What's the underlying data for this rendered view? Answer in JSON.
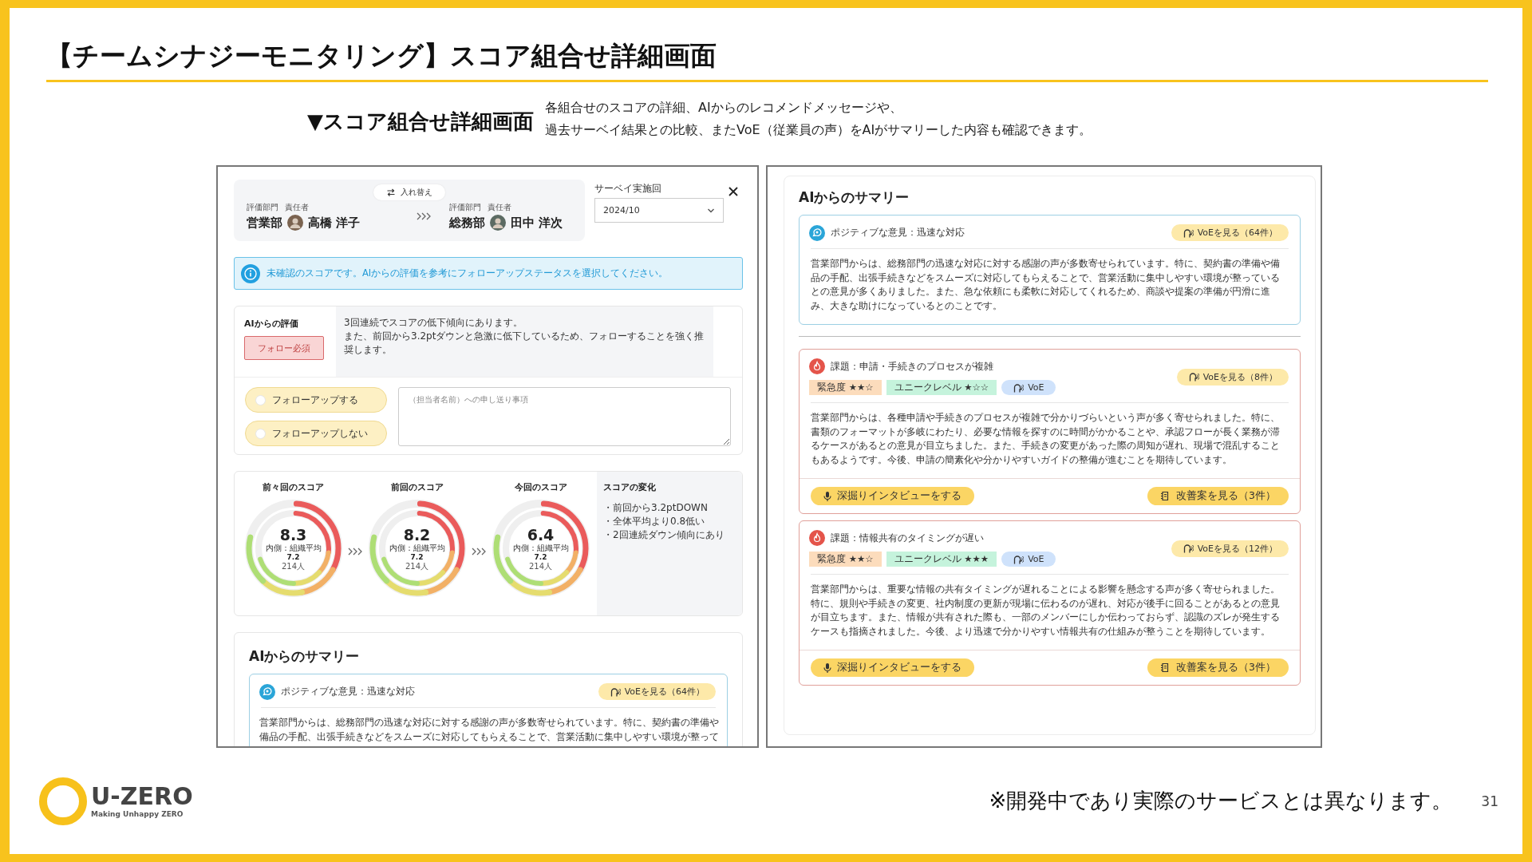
{
  "slide": {
    "title": "【チームシナジーモニタリング】スコア組合せ詳細画面",
    "subtitle": "▼スコア組合せ詳細画面",
    "description": [
      "各組合せのスコアの詳細、AIからのレコメンドメッセージや、",
      "過去サーベイ結果との比較、またVoE（従業員の声）をAIがサマリーした内容も確認できます。"
    ],
    "logo": {
      "name": "U-ZERO",
      "tagline": "Making Unhappy ZERO"
    },
    "note": "※開発中であり実際のサービスとは異なります。",
    "page_number": "31"
  },
  "detail_panel": {
    "swap_button": "入れ替え",
    "pair": [
      {
        "department_label": "評価部門",
        "manager_label": "責任者",
        "department": "営業部",
        "manager": "高橋 洋子"
      },
      {
        "department_label": "評価部門",
        "manager_label": "責任者",
        "department": "総務部",
        "manager": "田中 洋次"
      }
    ],
    "survey": {
      "label": "サーベイ実施回",
      "value": "2024/10"
    },
    "notice": "未確認のスコアです。AIからの評価を参考にフォローアップステータスを選択してください。",
    "ai_evaluation": {
      "label": "AIからの評価",
      "badge": "フォロー必須",
      "message": [
        "3回連続でスコアの低下傾向にあります。",
        "また、前回から3.2ptダウンと急激に低下しているため、フォローすることを強く推奨します。"
      ]
    },
    "follow_up_options": [
      {
        "label": "フォローアップする",
        "selected": false
      },
      {
        "label": "フォローアップしない",
        "selected": false
      }
    ],
    "handover": {
      "placeholder": "（担当者名前）への申し送り事項"
    },
    "scores": [
      {
        "title": "前々回のスコア",
        "score": "8.3",
        "inner_label": "内側：組織平均",
        "inner_value": "7.2",
        "respondents": "214人"
      },
      {
        "title": "前回のスコア",
        "score": "8.2",
        "inner_label": "内側：組織平均",
        "inner_value": "7.2",
        "respondents": "214人"
      },
      {
        "title": "今回のスコア",
        "score": "6.4",
        "inner_label": "内側：組織平均",
        "inner_value": "7.2",
        "respondents": "214人"
      }
    ],
    "score_change": {
      "title": "スコアの変化",
      "items": [
        "・前回から3.2ptDOWN",
        "・全体平均より0.8低い",
        "・2回連続ダウン傾向にあり"
      ]
    },
    "summary": {
      "title": "AIからのサマリー",
      "items": [
        {
          "kind": "positive",
          "title": "ポジティブな意見：迅速な対応",
          "voe_button": "VoEを見る（64件）",
          "text": "営業部門からは、総務部門の迅速な対応に対する感謝の声が多数寄せられています。特に、契約書の準備や備品の手配、出張手続きなどをスムーズに対応してもらえることで、営業活動に集中しやすい環境が整って"
        }
      ]
    }
  },
  "summary_panel": {
    "title": "AIからのサマリー",
    "items": [
      {
        "kind": "positive",
        "title": "ポジティブな意見：迅速な対応",
        "voe_button": "VoEを見る（64件）",
        "text": "営業部門からは、総務部門の迅速な対応に対する感謝の声が多数寄せられています。特に、契約書の準備や備品の手配、出張手続きなどをスムーズに対応してもらえることで、営業活動に集中しやすい環境が整っているとの意見が多くありました。また、急な依頼にも柔軟に対応してくれるため、商談や提案の準備が円滑に進み、大きな助けになっているとのことです。"
      },
      {
        "kind": "issue",
        "title": "課題：申請・手続きのプロセスが複雑",
        "tags": [
          {
            "kind": "urgency",
            "label": "緊急度 ★★☆"
          },
          {
            "kind": "uniqueness",
            "label": "ユニークレベル ★☆☆"
          },
          {
            "kind": "voe",
            "label": "VoE"
          }
        ],
        "voe_button": "VoEを見る（8件）",
        "text": "営業部門からは、各種申請や手続きのプロセスが複雑で分かりづらいという声が多く寄せられました。特に、書類のフォーマットが多岐にわたり、必要な情報を探すのに時間がかかることや、承認フローが長く業務が滞るケースがあるとの意見が目立ちました。また、手続きの変更があった際の周知が遅れ、現場で混乱することもあるようです。今後、申請の簡素化や分かりやすいガイドの整備が進むことを期待しています。",
        "actions": [
          {
            "kind": "interview",
            "label": "深掘りインタビューをする"
          },
          {
            "kind": "proposals",
            "label": "改善案を見る（3件）"
          }
        ]
      },
      {
        "kind": "issue",
        "title": "課題：情報共有のタイミングが遅い",
        "tags": [
          {
            "kind": "urgency",
            "label": "緊急度 ★★☆"
          },
          {
            "kind": "uniqueness",
            "label": "ユニークレベル ★★★"
          },
          {
            "kind": "voe",
            "label": "VoE"
          }
        ],
        "voe_button": "VoEを見る（12件）",
        "text": "営業部門からは、重要な情報の共有タイミングが遅れることによる影響を懸念する声が多く寄せられました。特に、規則や手続きの変更、社内制度の更新が現場に伝わるのが遅れ、対応が後手に回ることがあるとの意見が目立ちます。また、情報が共有された際も、一部のメンバーにしか伝わっておらず、認識のズレが発生するケースも指摘されました。今後、より迅速で分かりやすい情報共有の仕組みが整うことを期待しています。",
        "actions": [
          {
            "kind": "interview",
            "label": "深掘りインタビューをする"
          },
          {
            "kind": "proposals",
            "label": "改善案を見る（3件）"
          }
        ]
      }
    ]
  }
}
